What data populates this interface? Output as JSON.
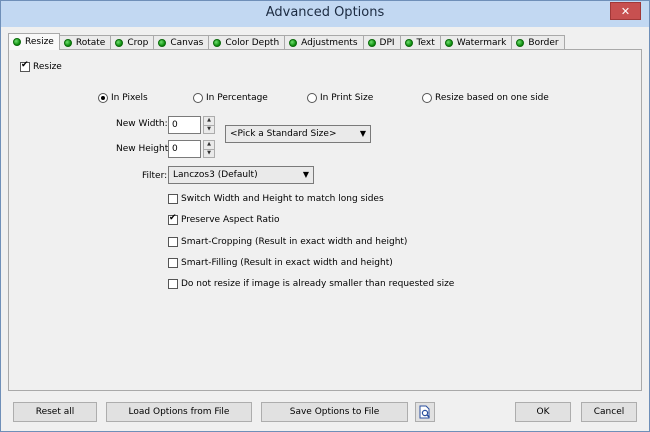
{
  "window": {
    "title": "Advanced Options",
    "close_glyph": "✕"
  },
  "tabs": [
    {
      "label": "Resize",
      "active": true
    },
    {
      "label": "Rotate"
    },
    {
      "label": "Crop"
    },
    {
      "label": "Canvas"
    },
    {
      "label": "Color Depth"
    },
    {
      "label": "Adjustments"
    },
    {
      "label": "DPI"
    },
    {
      "label": "Text"
    },
    {
      "label": "Watermark"
    },
    {
      "label": "Border"
    }
  ],
  "resize": {
    "enable_label": "Resize",
    "enable_checked": true,
    "modes": [
      {
        "label": "In Pixels",
        "selected": true
      },
      {
        "label": "In Percentage",
        "selected": false
      },
      {
        "label": "In Print Size",
        "selected": false
      },
      {
        "label": "Resize based on one side",
        "selected": false
      }
    ],
    "new_width_label": "New Width:",
    "new_width_value": "0",
    "new_height_label": "New Height:",
    "new_height_value": "0",
    "standard_size": "<Pick a Standard Size>",
    "filter_label": "Filter:",
    "filter_value": "Lanczos3 (Default)",
    "options": [
      {
        "label": "Switch Width and Height to match long sides",
        "checked": false
      },
      {
        "label": "Preserve Aspect Ratio",
        "checked": true
      },
      {
        "label": "Smart-Cropping (Result in exact width and height)",
        "checked": false
      },
      {
        "label": "Smart-Filling (Result in exact width and height)",
        "checked": false
      },
      {
        "label": "Do not resize if image is already smaller than requested size",
        "checked": false
      }
    ]
  },
  "footer": {
    "reset": "Reset all",
    "load": "Load Options from File",
    "save": "Save Options to File",
    "ok": "OK",
    "cancel": "Cancel"
  },
  "icons": {
    "tab_status": "green-dot-icon",
    "preview": "document-magnifier-icon"
  }
}
